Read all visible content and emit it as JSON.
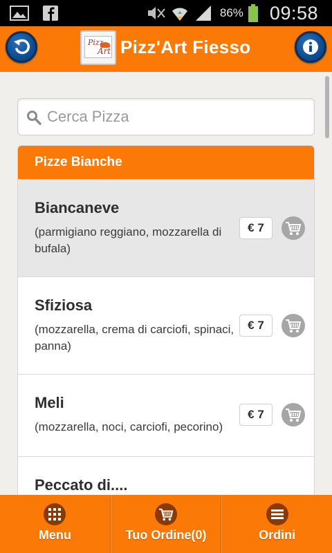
{
  "statusbar": {
    "battery_pct": "86%",
    "time": "09:58",
    "icons": [
      "gallery-icon",
      "facebook-icon",
      "mute-icon",
      "wifi-icon",
      "signal-icon",
      "battery-icon"
    ]
  },
  "header": {
    "title": "Pizz'Art Fiesso",
    "logo_text_1": "Pizz",
    "logo_text_2": "Art",
    "back_icon": "back-arrow-icon",
    "info_icon": "info-icon"
  },
  "search": {
    "placeholder": "Cerca Pizza",
    "value": ""
  },
  "category": {
    "title": "Pizze Bianche"
  },
  "items": [
    {
      "name": "Biancaneve",
      "desc": "(parmigiano reggiano, mozzarella di bufala)",
      "price": "€ 7"
    },
    {
      "name": "Sfiziosa",
      "desc": "(mozzarella, crema di carciofi, spinaci, panna)",
      "price": "€ 7"
    },
    {
      "name": "Meli",
      "desc": "(mozzarella, noci, carciofi, pecorino)",
      "price": "€ 7"
    },
    {
      "name": "Peccato di....",
      "desc": "",
      "price": ""
    }
  ],
  "nav": [
    {
      "label": "Menu",
      "icon": "grid-icon"
    },
    {
      "label": "Tuo Ordine(0)",
      "icon": "cart-icon"
    },
    {
      "label": "Ordini",
      "icon": "list-icon"
    }
  ],
  "colors": {
    "accent": "#fb7a07",
    "button_blue": "#0d4d93",
    "background": "#f1efec"
  }
}
